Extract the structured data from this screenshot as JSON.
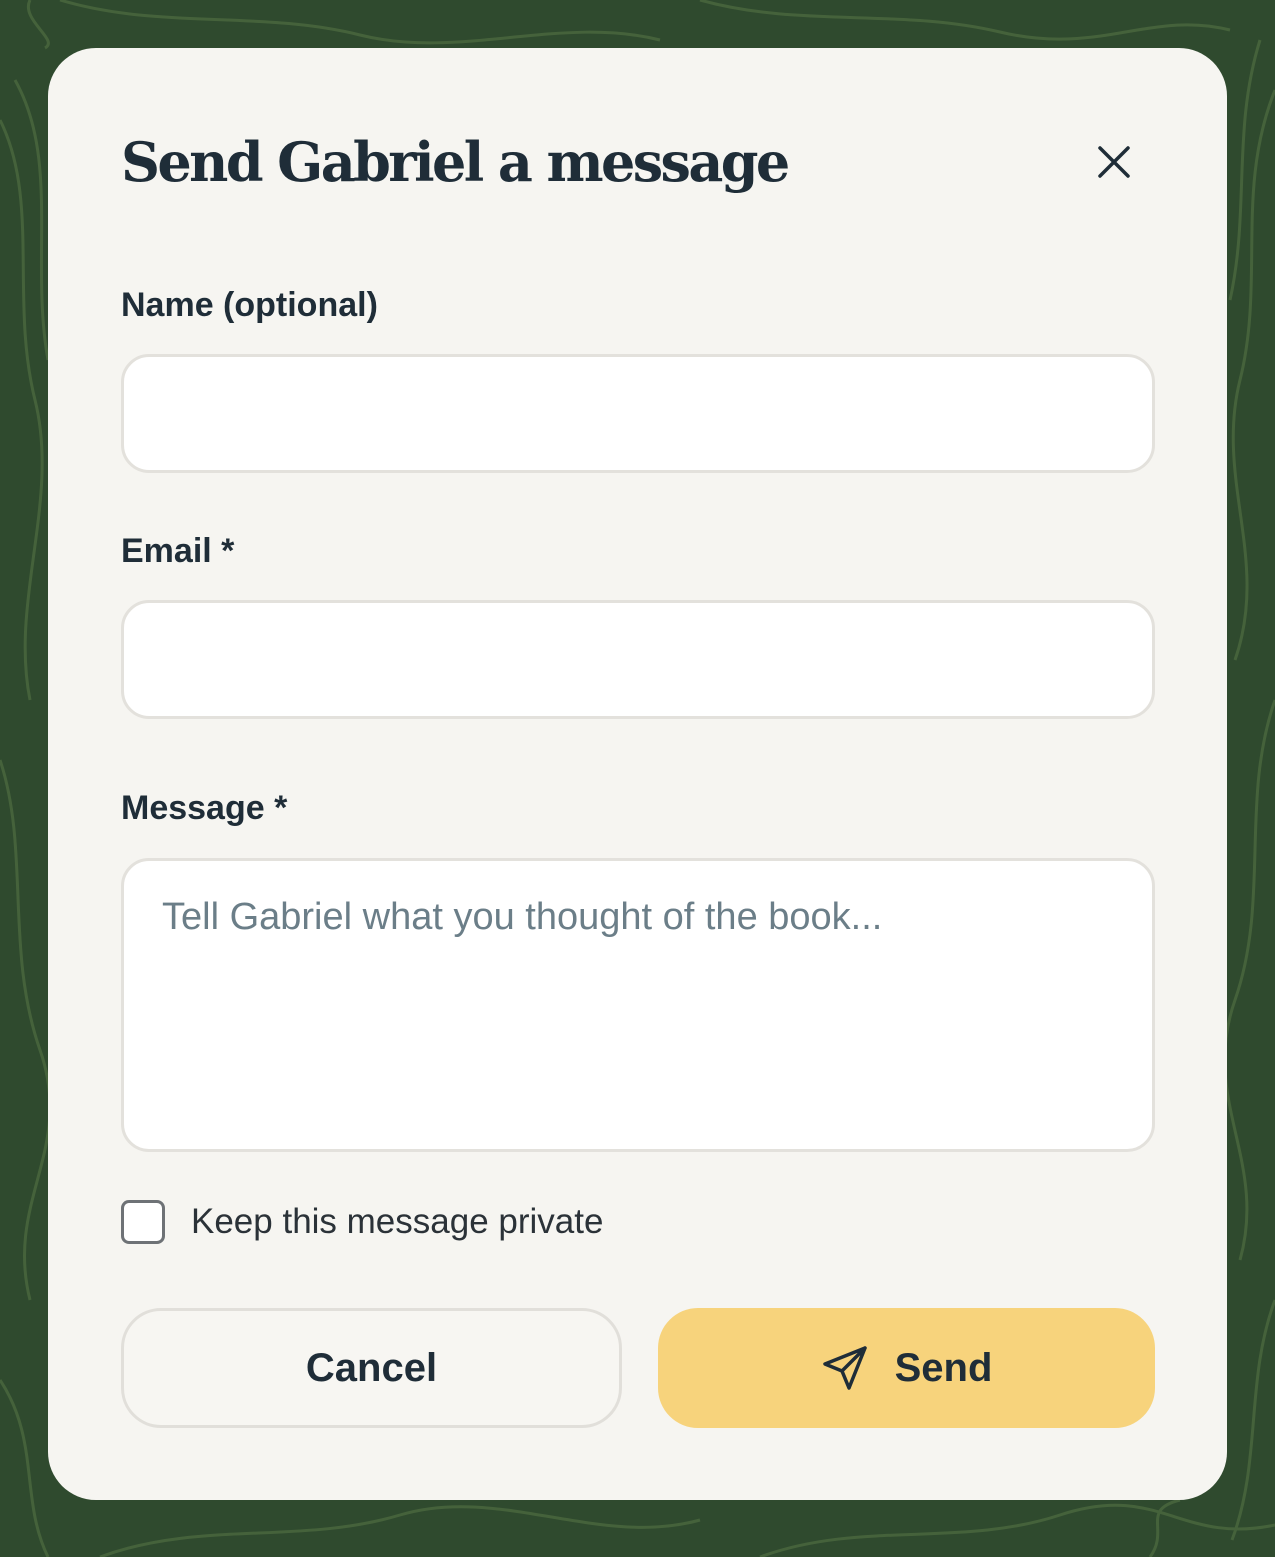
{
  "modal": {
    "title": "Send Gabriel a message",
    "close_icon": "close-icon"
  },
  "form": {
    "name_label": "Name (optional)",
    "name_value": "",
    "email_label": "Email *",
    "email_value": "",
    "message_label": "Message *",
    "message_placeholder": "Tell Gabriel what you thought of the book...",
    "message_value": "",
    "private_label": "Keep this message private",
    "private_checked": false
  },
  "actions": {
    "cancel_label": "Cancel",
    "send_label": "Send",
    "send_icon": "paper-plane-icon"
  },
  "colors": {
    "background": "#2f4a2e",
    "modal": "#f6f5f1",
    "text": "#1f2d38",
    "placeholder": "#6b7e88",
    "send_button": "#f7d37c",
    "field_border": "#e3e1dc"
  }
}
